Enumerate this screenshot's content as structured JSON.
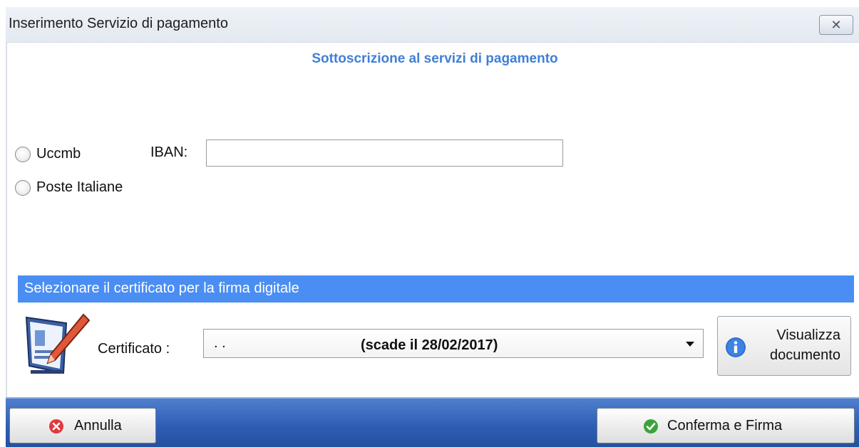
{
  "window": {
    "title": "Inserimento Servizio di pagamento",
    "close_glyph": "✕"
  },
  "form": {
    "heading": "Sottoscrizione al servizi di pagamento",
    "options": [
      {
        "label": "Uccmb",
        "selected": false
      },
      {
        "label": "Poste Italiane",
        "selected": false
      }
    ],
    "iban": {
      "label": "IBAN:",
      "value": ""
    }
  },
  "signature": {
    "section_title": "Selezionare il certificato per la firma digitale",
    "icon": "pen-document-icon",
    "certificate_label": "Certificato :",
    "certificate_prefix": ". .",
    "certificate_value": "(scade il 28/02/2017)",
    "view_button_line1": "Visualizza",
    "view_button_line2": "documento",
    "view_button_icon": "info-icon"
  },
  "footer": {
    "cancel_label": "Annulla",
    "cancel_icon": "cancel-icon",
    "confirm_label": "Conferma e Firma",
    "confirm_icon": "check-icon"
  },
  "colors": {
    "accent": "#3f7fd6",
    "section_bar": "#4a8ef3",
    "footer": "#2d5db3",
    "cancel_icon": "#e0393e",
    "confirm_icon": "#3ca33a",
    "info_icon": "#2f6fd1"
  }
}
